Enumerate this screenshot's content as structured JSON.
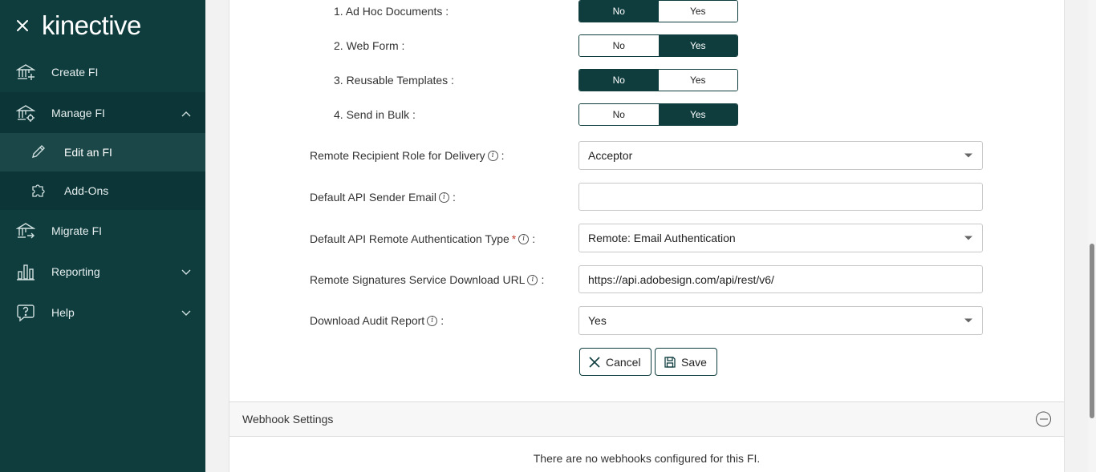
{
  "brand": {
    "logo_text": "kinective"
  },
  "sidebar": {
    "items": [
      {
        "label": "Create FI",
        "icon": "bank-plus-icon"
      },
      {
        "label": "Manage FI",
        "icon": "bank-gear-icon"
      },
      {
        "label": "Migrate FI",
        "icon": "bank-arrow-icon"
      },
      {
        "label": "Reporting",
        "icon": "bar-chart-icon"
      },
      {
        "label": "Help",
        "icon": "help-bubble-icon"
      }
    ],
    "subitems": [
      {
        "label": "Edit an FI",
        "icon": "pencil-icon"
      },
      {
        "label": "Add-Ons",
        "icon": "puzzle-icon"
      }
    ]
  },
  "toggles": [
    {
      "label": "1. Ad Hoc Documents :",
      "no": "No",
      "yes": "Yes",
      "selected": "No"
    },
    {
      "label": "2. Web Form :",
      "no": "No",
      "yes": "Yes",
      "selected": "Yes"
    },
    {
      "label": "3. Reusable Templates :",
      "no": "No",
      "yes": "Yes",
      "selected": "No"
    },
    {
      "label": "4. Send in Bulk :",
      "no": "No",
      "yes": "Yes",
      "selected": "Yes"
    }
  ],
  "fields": {
    "remote_role": {
      "label": "Remote Recipient Role for Delivery",
      "value": "Acceptor"
    },
    "api_sender_email": {
      "label": "Default API Sender Email",
      "value": ""
    },
    "auth_type": {
      "label": "Default API Remote Authentication Type",
      "value": "Remote: Email Authentication"
    },
    "download_url": {
      "label": "Remote Signatures Service Download URL",
      "value": "https://api.adobesign.com/api/rest/v6/"
    },
    "audit_report": {
      "label": "Download Audit Report",
      "value": "Yes"
    }
  },
  "colon": ":",
  "info_glyph": "i",
  "required_mark": "*",
  "buttons": {
    "cancel": "Cancel",
    "save": "Save"
  },
  "webhook": {
    "title": "Webhook Settings",
    "empty_message": "There are no webhooks configured for this FI."
  },
  "colors": {
    "sidebar": "#0f3d3e",
    "accent": "#0f3d3e",
    "required": "#c0392b"
  }
}
